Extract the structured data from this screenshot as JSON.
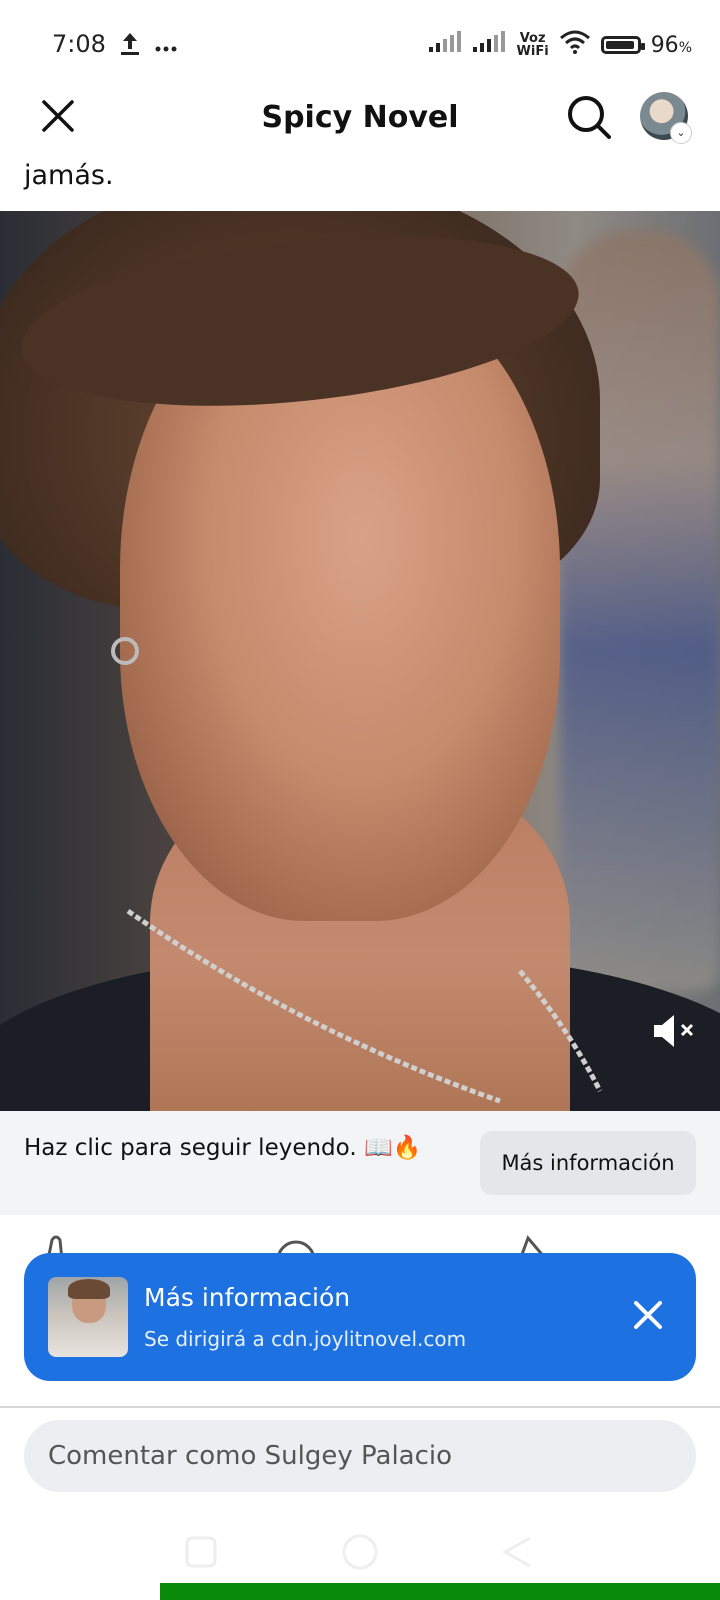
{
  "status_bar": {
    "time": "7:08",
    "voz": "Voz",
    "wifi_label": "WiFi",
    "battery_percent": "96",
    "battery_unit": "%",
    "battery_level": 0.96
  },
  "header": {
    "title": "Spicy Novel"
  },
  "post": {
    "text_fragment": "jamás."
  },
  "cta": {
    "text": "Haz clic para seguir leyendo. 📖🔥",
    "button_label": "Más información"
  },
  "toast": {
    "title": "Más información",
    "subtitle": "Se dirigirá a cdn.joylitnovel.com"
  },
  "comment": {
    "placeholder": "Comentar como Sulgey Palacio"
  },
  "colors": {
    "toast_blue": "#1d71e0",
    "bottom_bar_green": "#0a8a0a"
  }
}
